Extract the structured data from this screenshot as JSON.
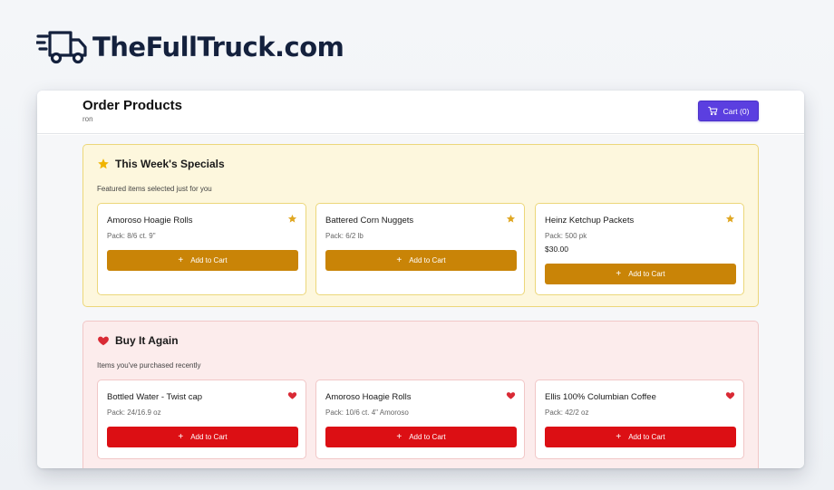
{
  "brand": {
    "name": "TheFullTruck.com",
    "icon": "delivery-truck-icon",
    "color": "#14213d"
  },
  "header": {
    "title": "Order Products",
    "subtitle": "ron"
  },
  "cart": {
    "label": "Cart (0)",
    "icon": "shopping-cart-icon",
    "color": "#5b3fe0"
  },
  "sections": {
    "specials": {
      "title": "This Week's Specials",
      "description": "Featured items selected just for you",
      "icon": "star-icon",
      "accent": "#c98407",
      "items": [
        {
          "name": "Amoroso Hoagie Rolls",
          "pack": "Pack: 8/6 ct. 9\"",
          "price": "",
          "button": "Add to Cart"
        },
        {
          "name": "Battered Corn Nuggets",
          "pack": "Pack: 6/2 lb",
          "price": "",
          "button": "Add to Cart"
        },
        {
          "name": "Heinz Ketchup Packets",
          "pack": "Pack: 500 pk",
          "price": "$30.00",
          "button": "Add to Cart"
        }
      ]
    },
    "again": {
      "title": "Buy It Again",
      "description": "Items you've purchased recently",
      "icon": "heart-icon",
      "accent": "#dc0f14",
      "items": [
        {
          "name": "Bottled Water - Twist cap",
          "pack": "Pack: 24/16.9 oz",
          "button": "Add to Cart"
        },
        {
          "name": "Amoroso Hoagie Rolls",
          "pack": "Pack: 10/6 ct. 4\" Amoroso",
          "button": "Add to Cart"
        },
        {
          "name": "Ellis 100% Columbian Coffee",
          "pack": "Pack: 42/2 oz",
          "button": "Add to Cart"
        }
      ]
    }
  }
}
